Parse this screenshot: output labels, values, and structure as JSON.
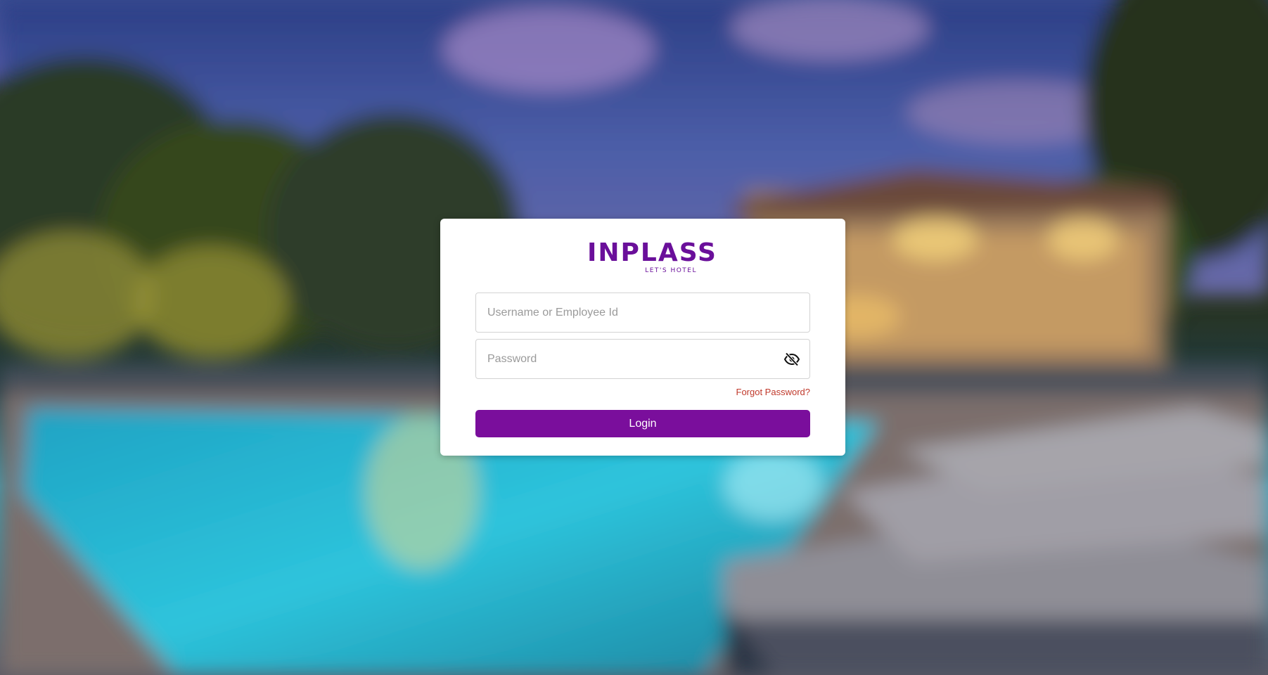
{
  "brand": {
    "name": "INPLASS",
    "tagline": "LET'S HOTEL",
    "color": "#6a0f9a"
  },
  "login_form": {
    "username": {
      "placeholder": "Username or Employee Id",
      "value": ""
    },
    "password": {
      "placeholder": "Password",
      "value": ""
    },
    "toggle_visibility_icon": "eye-slash-icon",
    "forgot_label": "Forgot Password?",
    "submit_label": "Login"
  },
  "colors": {
    "accent": "#7a0e9c",
    "forgot_link": "#c0392b",
    "card_bg": "#ffffff"
  }
}
